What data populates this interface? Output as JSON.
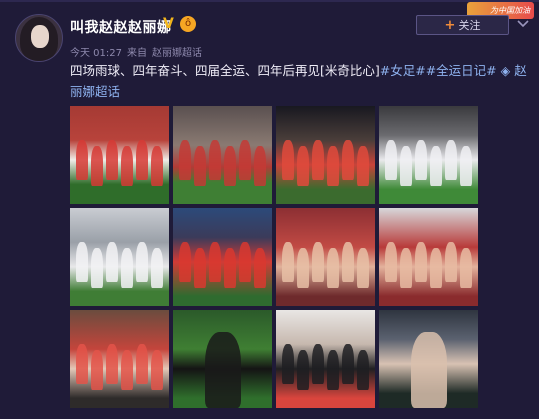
{
  "header": {
    "username": "叫我赵赵赵丽娜",
    "verified_mark": "V",
    "member_mark": "ô",
    "time": "今天 01:27",
    "source_prefix": "来自",
    "source": "赵丽娜超话",
    "follow_plus": "+",
    "follow_label": "关注",
    "promo": "为中国加油"
  },
  "post": {
    "text": "四场雨球、四年奋斗、四届全运、四年后再见[米奇比心]",
    "tags": "#女足##全运日记#",
    "topic_icon": "◈",
    "topic": " 赵丽娜超话"
  },
  "icons": {
    "chevron": "chevron-down-icon",
    "topic": "supertopic-icon"
  },
  "photos": [
    {
      "label": "team-celebration-red"
    },
    {
      "label": "team-lineup-stadium"
    },
    {
      "label": "team-night-celebration"
    },
    {
      "label": "team-white-kit-group"
    },
    {
      "label": "team-huddle-white"
    },
    {
      "label": "team-hug-pile"
    },
    {
      "label": "selfie-group-red"
    },
    {
      "label": "selfie-group-indoor"
    },
    {
      "label": "players-medals"
    },
    {
      "label": "goalkeeper-heart-pose"
    },
    {
      "label": "interview-microphones"
    },
    {
      "label": "goalkeeper-portrait"
    }
  ]
}
